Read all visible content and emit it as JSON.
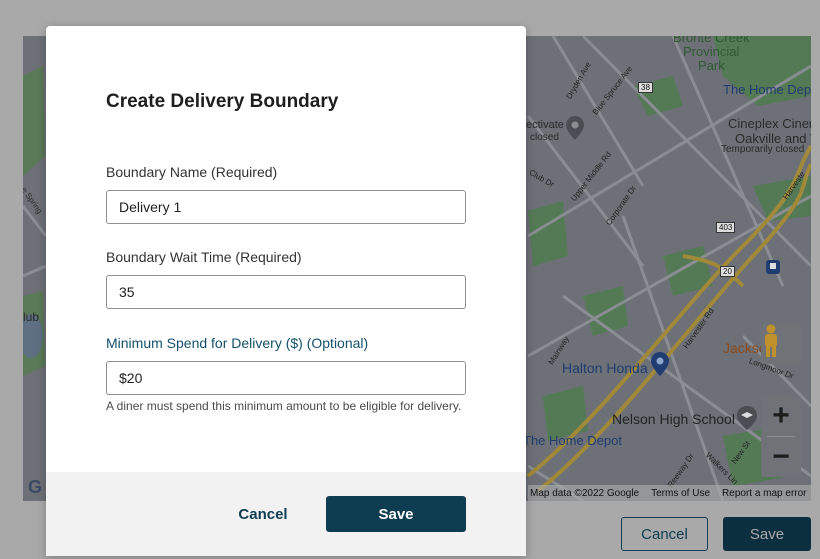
{
  "modal": {
    "title": "Create Delivery Boundary",
    "boundary_name": {
      "label": "Boundary Name (Required)",
      "value": "Delivery 1"
    },
    "wait_time": {
      "label": "Boundary Wait Time (Required)",
      "value": "35"
    },
    "min_spend": {
      "label": "Minimum Spend for Delivery ($) (Optional)",
      "value": "$20",
      "hint": "A diner must spend this minimum amount to be eligible for delivery."
    },
    "cancel_label": "Cancel",
    "save_label": "Save"
  },
  "page": {
    "cancel_label": "Cancel",
    "save_label": "Save"
  },
  "map": {
    "labels": {
      "bronte_creek": "Bronte Creek",
      "provincial": "Provincial",
      "park": "Park",
      "home_depot_top": "The Home Dep",
      "cineplex": "Cineplex Cinemas",
      "oakville": "Oakville and VIP",
      "temporarily_closed": "Temporarily closed",
      "ectivate": "ectivate",
      "closed": "closed",
      "halton_honda": "Halton Honda",
      "jacksons": "Jacksons L",
      "nelson_high_school": "Nelson High School",
      "home_depot_bottom": "The Home Depot",
      "club": "lub",
      "dryden_ave": "Dryden Ave",
      "blue_spruce_ave": "Blue Spruce Ave",
      "upper_middle_rd": "Upper Middle Rd",
      "corporate_dr": "Corporate Dr",
      "club_dr": "Club Dr",
      "mainway": "Mainway",
      "harvester_rd": "Harvester Rd",
      "harvester": "Harveste",
      "reeway_dr": "Reeway Dr",
      "walkers_line": "Walkers Lin",
      "new_st": "New St",
      "longmoor_dr": "Longmoor Dr",
      "spring": "e Spring",
      "route_38": "38",
      "route_403": "403",
      "route_20": "20"
    },
    "footer": {
      "map_data": "Map data ©2022 Google",
      "terms": "Terms of Use",
      "report": "Report a map error"
    },
    "colors": {
      "park": "#537a55",
      "road": "#8a8d92",
      "highway": "#a1893a",
      "water": "#5d6f80"
    }
  },
  "icons": [
    "pegman-icon",
    "zoom-in-icon",
    "zoom-out-icon",
    "map-pin-icon",
    "school-icon",
    "transit-icon",
    "google-logo"
  ]
}
